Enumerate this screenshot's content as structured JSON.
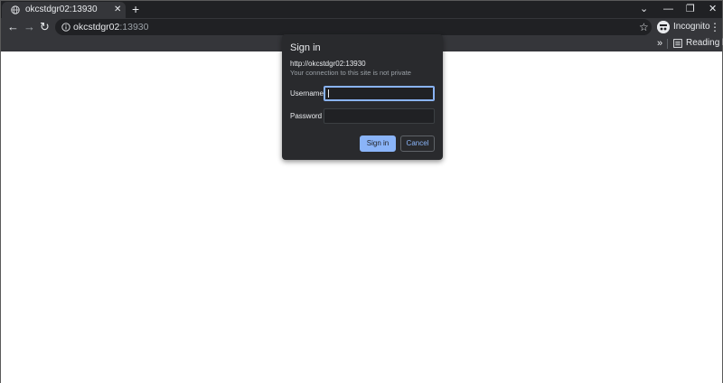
{
  "tab": {
    "title": "okcstdgr02:13930",
    "close": "✕"
  },
  "new_tab": "+",
  "window_controls": {
    "tab_search": "⌄",
    "minimize": "—",
    "restore": "❐",
    "close": "✕"
  },
  "toolbar": {
    "back": "←",
    "forward": "→",
    "reload": "↻",
    "url_host": "okcstdgr02",
    "url_port": ":13930",
    "bookmark_star": "☆",
    "profile_label": "Incognito",
    "menu": "⋮"
  },
  "bookmarks": {
    "overflow": "»",
    "reading_list": "Reading list"
  },
  "dialog": {
    "title": "Sign in",
    "url": "http://okcstdgr02:13930",
    "warning": "Your connection to this site is not private",
    "username_label": "Username",
    "username_value": "",
    "password_label": "Password",
    "password_value": "",
    "signin_label": "Sign in",
    "cancel_label": "Cancel"
  },
  "colors": {
    "tabstrip": "#202124",
    "toolbar": "#35363a",
    "dialog": "#292a2d",
    "accent": "#8ab4f8"
  }
}
